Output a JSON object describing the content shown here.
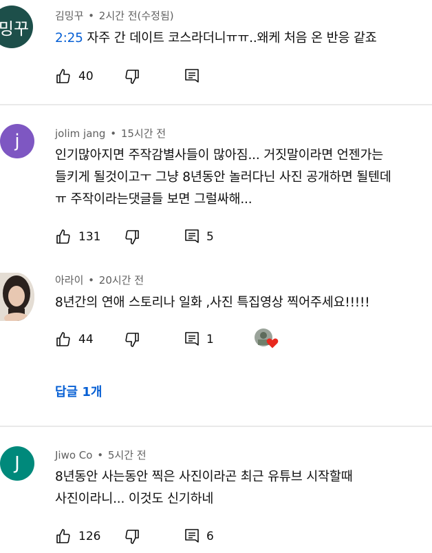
{
  "comments": [
    {
      "avatar_text": "밍꾸",
      "avatar_color": "#1d4f4a",
      "author": "김밍꾸",
      "time": "2시간 전(수정됨)",
      "timestamp_link": "2:25",
      "text": " 자주 간 데이트 코스라더니ㅠㅠ..왜케 처음 온 반응 같죠",
      "likes": "40",
      "replies": ""
    },
    {
      "avatar_text": "j",
      "avatar_color": "#7e57c2",
      "author": "jolim jang",
      "time": "15시간 전",
      "text_lines": [
        "인기많아지면 주작감별사들이 많아짐... 거짓말이라면 언젠가는",
        "들키게 될것이고ㅜ 그냥 8년동안 놀러다닌 사진 공개하면 될텐데",
        "ㅠ 주작이라는댓글들 보면 그럴싸해..."
      ],
      "likes": "131",
      "replies": "5"
    },
    {
      "author": "아라이",
      "time": "20시간 전",
      "text": "8년간의 연애 스토리나 일화 ,사진 특집영상 찍어주세요!!!!!",
      "likes": "44",
      "replies": "1",
      "reply_link": "답글 1개"
    },
    {
      "avatar_text": "J",
      "avatar_color": "#00897b",
      "author": "Jiwo Co",
      "time": "5시간 전",
      "text_lines": [
        "8년동안 사는동안 찍은 사진이라곤 최근 유튜브 시작할때",
        "사진이라니... 이것도 신기하네"
      ],
      "likes": "126",
      "replies": "6"
    }
  ],
  "icons": {
    "like": "thumbs-up-icon",
    "dislike": "thumbs-down-icon",
    "reply": "reply-icon",
    "heart": "creator-heart-icon"
  },
  "colors": {
    "link": "#065fd4",
    "meta": "#606060",
    "heart": "#e8281e"
  }
}
